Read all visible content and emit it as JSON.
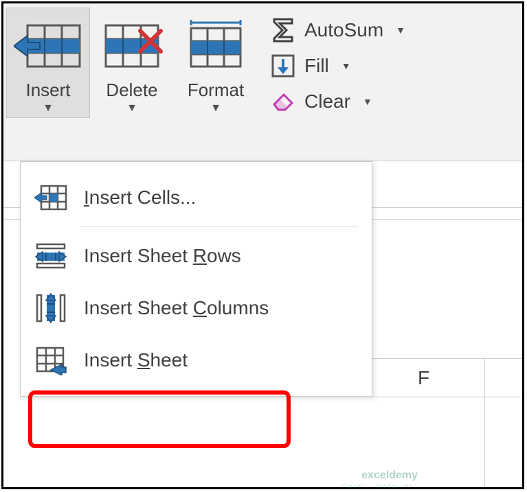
{
  "ribbon": {
    "cells_group": {
      "insert": {
        "label": "Insert"
      },
      "delete": {
        "label": "Delete"
      },
      "format": {
        "label": "Format"
      }
    },
    "editing_group": {
      "autosum": {
        "label": "AutoSum"
      },
      "fill": {
        "label": "Fill"
      },
      "clear": {
        "label": "Clear"
      }
    }
  },
  "dropdown": {
    "insert_cells": {
      "prefix": "",
      "underline": "I",
      "suffix": "nsert Cells..."
    },
    "insert_rows": {
      "prefix": "Insert Sheet ",
      "underline": "R",
      "suffix": "ows"
    },
    "insert_columns": {
      "prefix": "Insert Sheet ",
      "underline": "C",
      "suffix": "olumns"
    },
    "insert_sheet": {
      "prefix": "Insert ",
      "underline": "S",
      "suffix": "heet"
    }
  },
  "grid": {
    "column_f": "F"
  },
  "watermark": {
    "main": "exceldemy",
    "sub": "EXCEL · DATA · BI"
  }
}
